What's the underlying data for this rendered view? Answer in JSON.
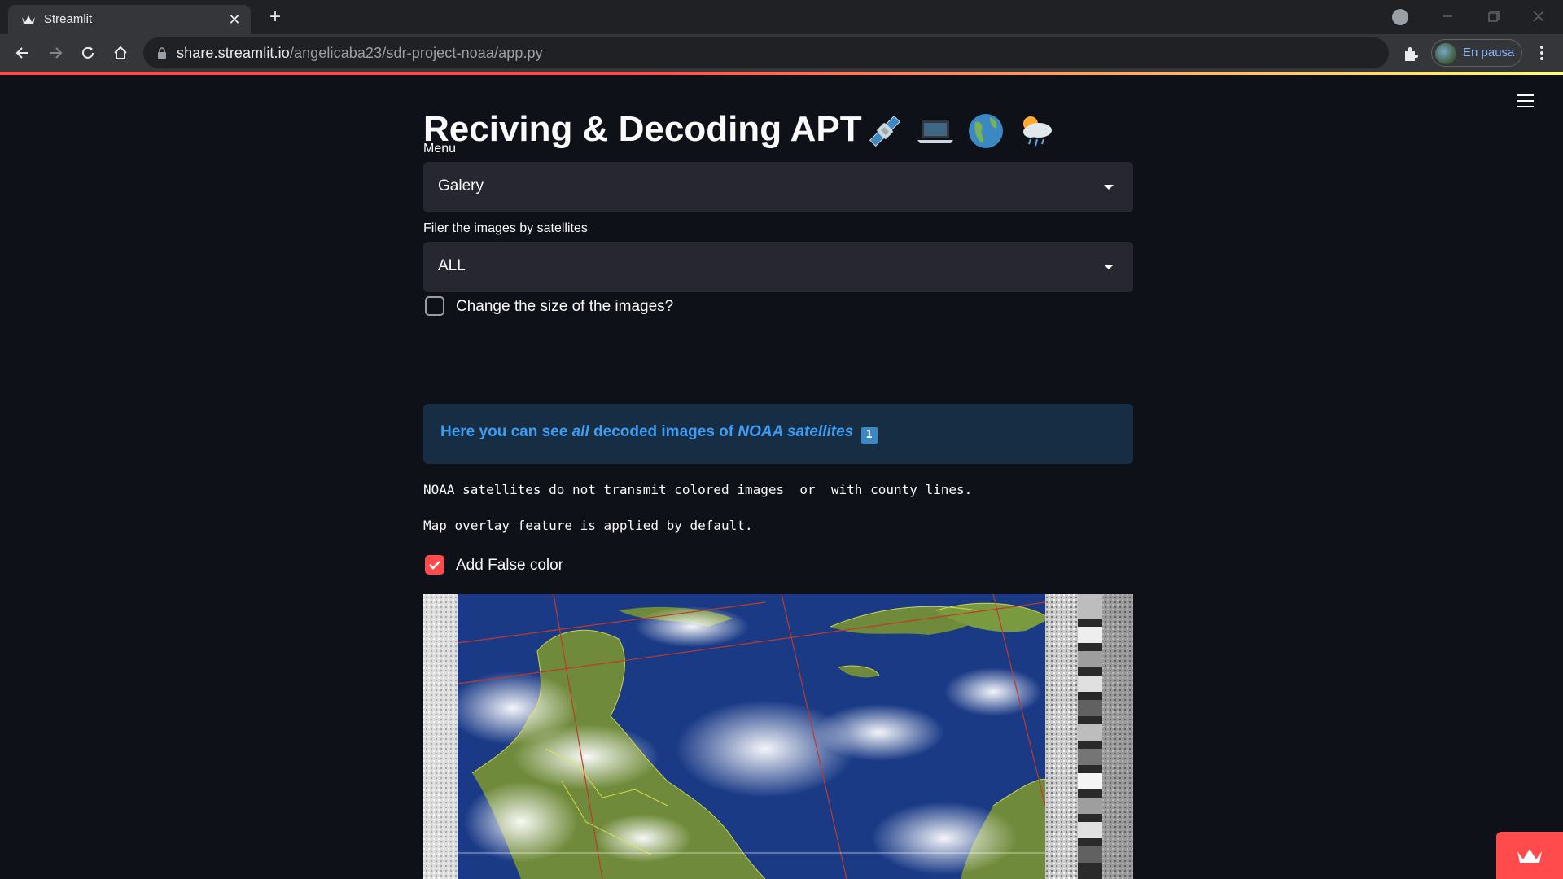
{
  "browser": {
    "tab_title": "Streamlit",
    "url_host": "share.streamlit.io",
    "url_path": "/angelicaba23/sdr-project-noaa/app.py",
    "profile_label": "En pausa"
  },
  "app": {
    "title": "Reciving & Decoding APT",
    "title_emojis": [
      "satellite-icon",
      "laptop-icon",
      "globe-icon",
      "sun-cloud-rain-icon"
    ],
    "menu": {
      "label": "Menu",
      "value": "Galery"
    },
    "filter": {
      "label": "Filer the images by satellites",
      "value": "ALL"
    },
    "resize_checkbox": {
      "label": "Change the size of the images?",
      "checked": false
    },
    "info": {
      "part1": "Here you can see ",
      "part2": "all",
      "part3": " decoded images of ",
      "part4": "NOAA satellites",
      "badge": "1"
    },
    "note_1": "NOAA satellites do not transmit colored images  or  with county lines.",
    "note_2": "Map overlay feature is applied by default.",
    "false_color_checkbox": {
      "label": "Add False color",
      "checked": true
    }
  },
  "colors": {
    "background": "#0e1117",
    "accent": "#ff4b4b",
    "info_bg": "#172d43",
    "info_text": "#3d9df3",
    "widget_bg": "#262730"
  }
}
